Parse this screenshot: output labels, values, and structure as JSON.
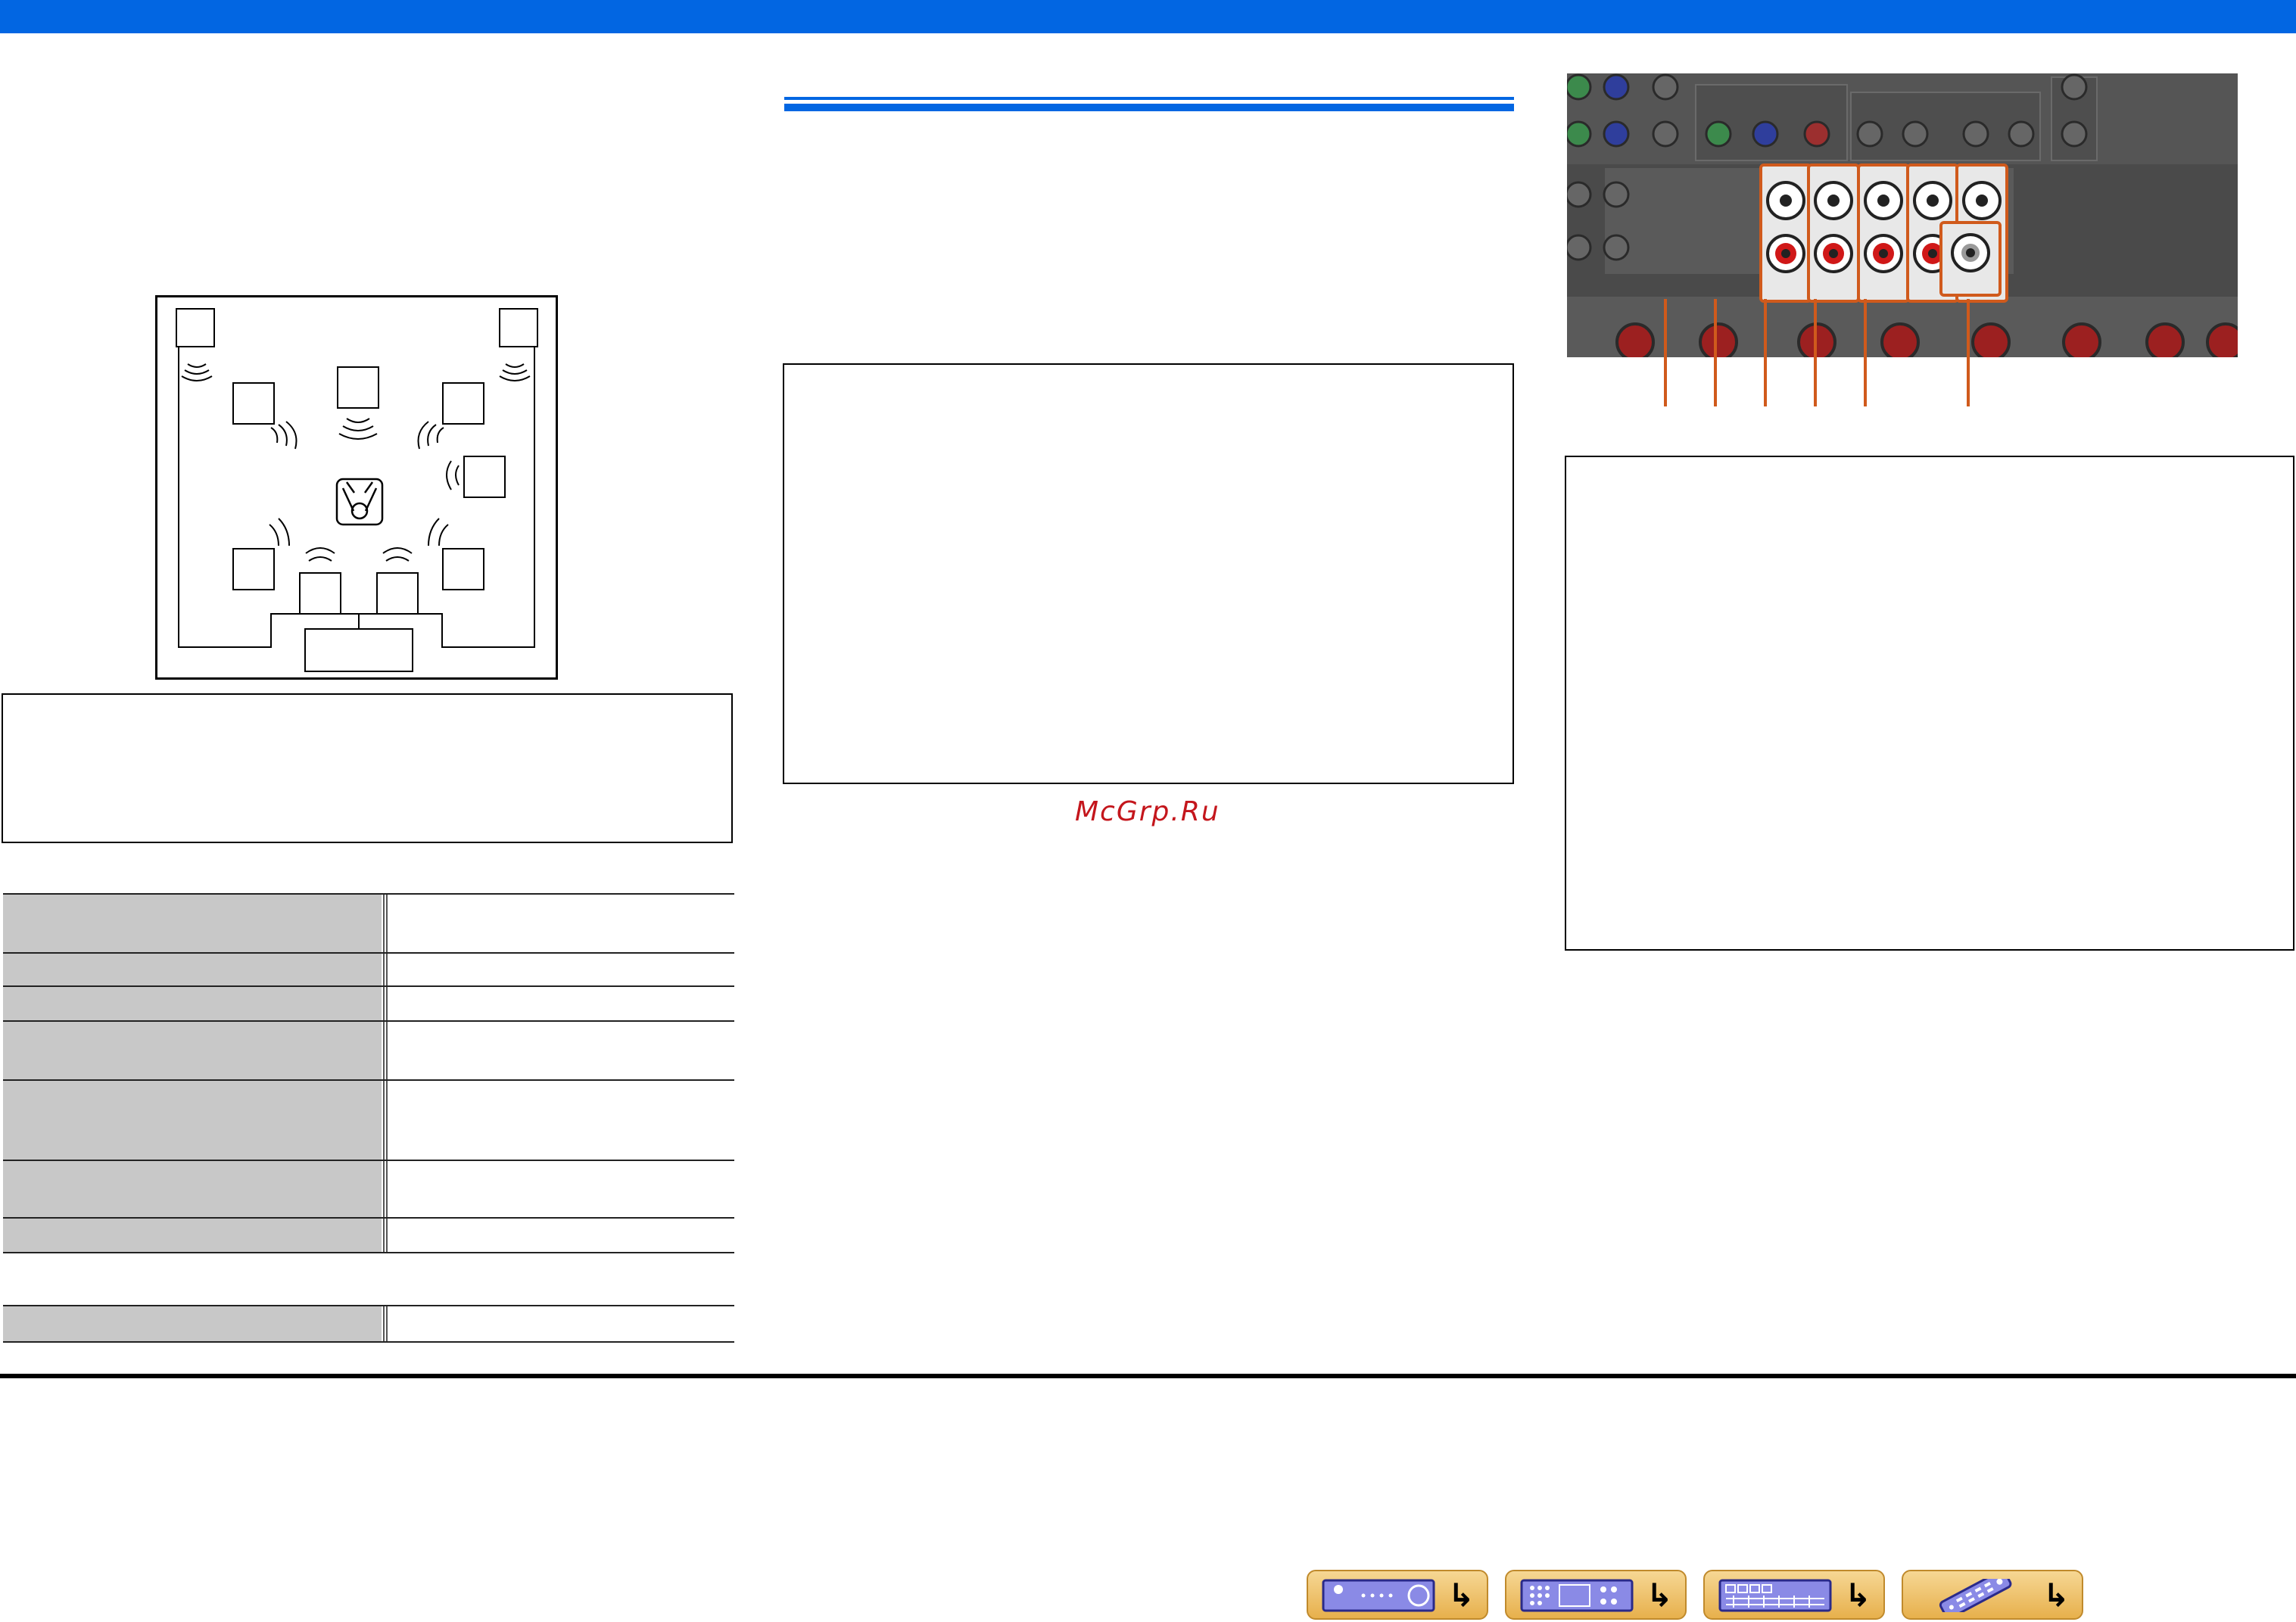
{
  "watermark": "McGrp.Ru",
  "colors": {
    "header_bar": "#0266e2",
    "section_rule": "#0266e2",
    "callout_orange": "#d05a1c",
    "nav_button": "#e7b04c",
    "watermark": "#c4161c"
  },
  "speaker_diagram": {
    "speaker_boxes": 10,
    "listener_icon": "listener-icon"
  },
  "rear_panel": {
    "callout_count": 6,
    "jack_pairs": 5,
    "single_jack": 1
  },
  "spec_table": {
    "rows": 7,
    "extra_rows": 1
  },
  "nav_buttons": [
    {
      "name": "front-panel-nav-button",
      "icon": "receiver-front-icon"
    },
    {
      "name": "rear-panel-nav-button",
      "icon": "receiver-rear-icon"
    },
    {
      "name": "display-nav-button",
      "icon": "display-icon"
    },
    {
      "name": "remote-nav-button",
      "icon": "remote-control-icon"
    }
  ],
  "nav_arrow": "↳"
}
